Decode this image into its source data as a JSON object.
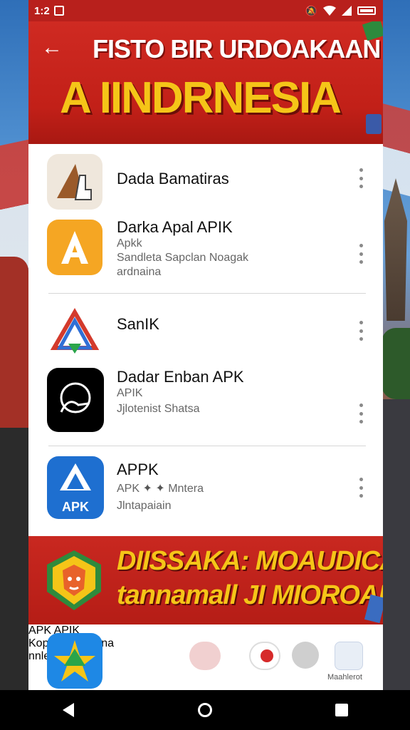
{
  "status_bar": {
    "time": "1:2",
    "icons": [
      "gallery-icon",
      "mute-icon",
      "wifi-icon",
      "signal-icon",
      "battery-icon"
    ]
  },
  "header": {
    "title_line1": "FISTO BIR URDOAKAAN",
    "title_line2": "A IINDRNESIA"
  },
  "apps": [
    {
      "name": "Dada Bamatiras",
      "sub1": "",
      "sub2": "",
      "icon": "hand-tent-icon"
    },
    {
      "name": "Darka Apal APIK",
      "sub1": "Apkk",
      "sub2": "Sandleta Sapclan Noagak",
      "sub3": "ardnaina",
      "icon": "letter-a-icon"
    },
    {
      "name": "SanIK",
      "sub1": "",
      "sub2": "",
      "icon": "triangle-logo-icon"
    },
    {
      "name": "Dadar Enban APK",
      "sub1": "APIK",
      "sub2": "Jjlotenist Shatsa",
      "icon": "face-outline-icon"
    },
    {
      "name": "APPK",
      "sub1": "APK",
      "sub1b": "Mntera",
      "sub2": "Jlntapaiain",
      "icon": "apk-blue-icon",
      "icon_label": "APK"
    }
  ],
  "promo": {
    "line1": "DIISSAKA: MOAUDICAM",
    "line2": "tannamall JI MIOROAN?"
  },
  "last_item": {
    "name": "APK APIK",
    "sub1": "Kopltak Irlentana",
    "sub2": "nnlemnamn",
    "tool_label": "Maahlerot"
  },
  "colors": {
    "header_red": "#c92820",
    "title_yellow": "#f5c518",
    "panel_white": "#ffffff"
  }
}
